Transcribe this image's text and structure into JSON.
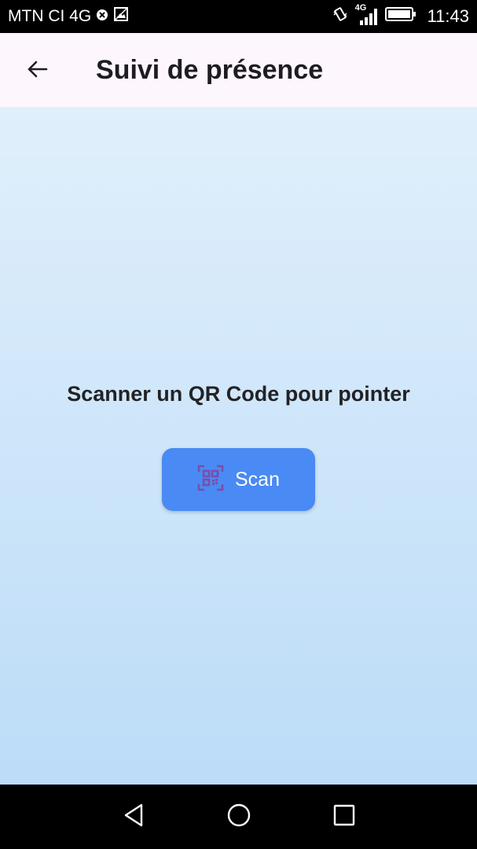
{
  "status_bar": {
    "carrier": "MTN CI 4G",
    "network": "4G",
    "time": "11:43",
    "icons": [
      "blocked-icon",
      "image-icon",
      "vibrate-icon",
      "signal-icon",
      "battery-icon"
    ]
  },
  "app_bar": {
    "title": "Suivi de présence",
    "back_icon": "arrow-left-icon"
  },
  "main": {
    "prompt": "Scanner un QR Code pour pointer",
    "scan_button": {
      "label": "Scan",
      "icon": "qr-code-icon"
    }
  },
  "nav_bar": {
    "icons": [
      "back-triangle-icon",
      "home-circle-icon",
      "recents-square-icon"
    ]
  },
  "colors": {
    "app_bar_bg": "#fdf6fd",
    "content_top": "#e0effb",
    "content_bottom": "#bcdcf8",
    "button_bg": "#4a8af4",
    "qr_icon": "#7b4ea8"
  }
}
